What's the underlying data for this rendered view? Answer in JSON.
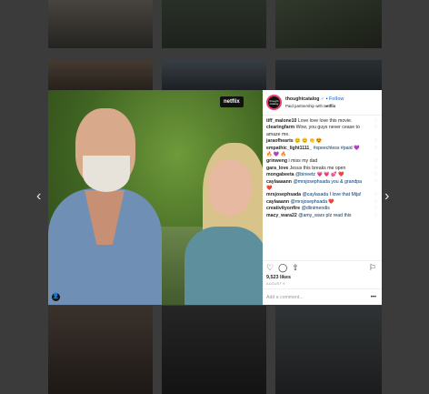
{
  "modal": {
    "overlay_label": "netflix",
    "header": {
      "avatar_text": "thought catalog",
      "username": "thoughtcatalog",
      "verified_icon": "✓",
      "follow_label": "Follow",
      "partnership_prefix": "Paid partnership with",
      "partner_name": "netflix"
    },
    "comments": [
      {
        "user": "tiff_malone10",
        "text": "Love love love this movie."
      },
      {
        "user": "clearingfarm",
        "text": "Wow, you guys never cease to amaze me."
      },
      {
        "user": "jaraofhearts",
        "text": "😊 😊 👏 😍"
      },
      {
        "user": "empathic_light1111_",
        "text": "#speechless #paid 💜 🔥 💜 🔥"
      },
      {
        "user": "grinweng",
        "text": "i miss my dad"
      },
      {
        "user": "gara_love",
        "text": "Jesus this breaks me open"
      },
      {
        "user": "mongabeeta",
        "text": "@bineetz 💗 💗 💕 ❤️"
      },
      {
        "user": "caylaaaann",
        "text": "@mrsjosephsada you & grandpa ❤️"
      },
      {
        "user": "mrsjosephsada",
        "text": "@caylasada I love that Mija!"
      },
      {
        "user": "caylaaann",
        "text": "@mrsjosephsada ❤️"
      },
      {
        "user": "creativityonfire",
        "text": "@dlinimendis"
      },
      {
        "user": "macy_wara22",
        "text": "@amy_wars plz read this"
      }
    ],
    "likes": "9,523 likes",
    "date": "AUGUST 9",
    "add_comment_placeholder": "Add a comment..."
  },
  "icons": {
    "prev": "‹",
    "next": "›",
    "heart": "♡",
    "comment": "◯",
    "share": "⇧",
    "bookmark": "⚐",
    "more": "•••",
    "tag": "👤",
    "comment_like": "♡"
  }
}
